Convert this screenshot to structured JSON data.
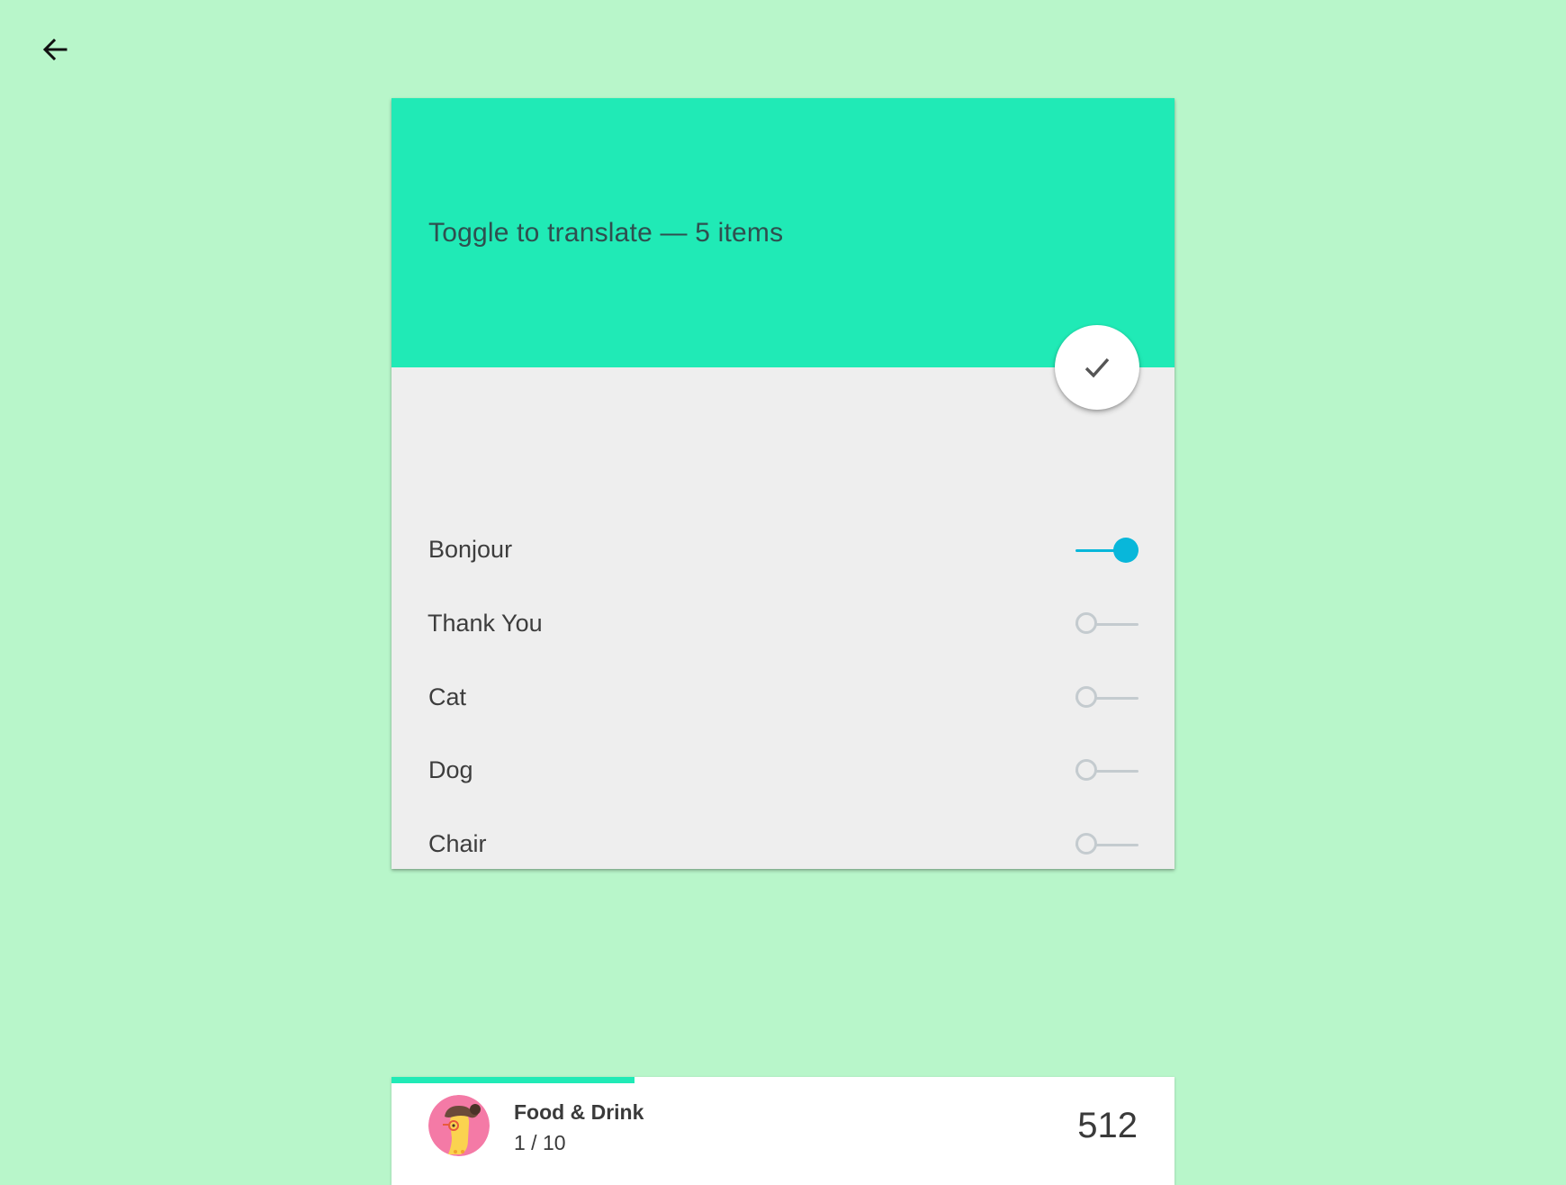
{
  "nav": {
    "back_icon": "arrow-back-icon"
  },
  "card": {
    "title": "Toggle to translate — 5 items",
    "header_color": "#20eab6",
    "fab_icon": "check-icon",
    "items": [
      {
        "label": "Bonjour",
        "on": true
      },
      {
        "label": "Thank You",
        "on": false
      },
      {
        "label": "Cat",
        "on": false
      },
      {
        "label": "Dog",
        "on": false
      },
      {
        "label": "Chair",
        "on": false
      }
    ]
  },
  "colors": {
    "background": "#b8f6ca",
    "accent": "#20eab6",
    "switch_on": "#08b7da",
    "switch_off": "#c4cbcf"
  },
  "bottom": {
    "category": "Food & Drink",
    "progress_text": "1 / 10",
    "progress_fraction": 0.31,
    "score": "512",
    "avatar_icon": "avatar-character-icon"
  }
}
